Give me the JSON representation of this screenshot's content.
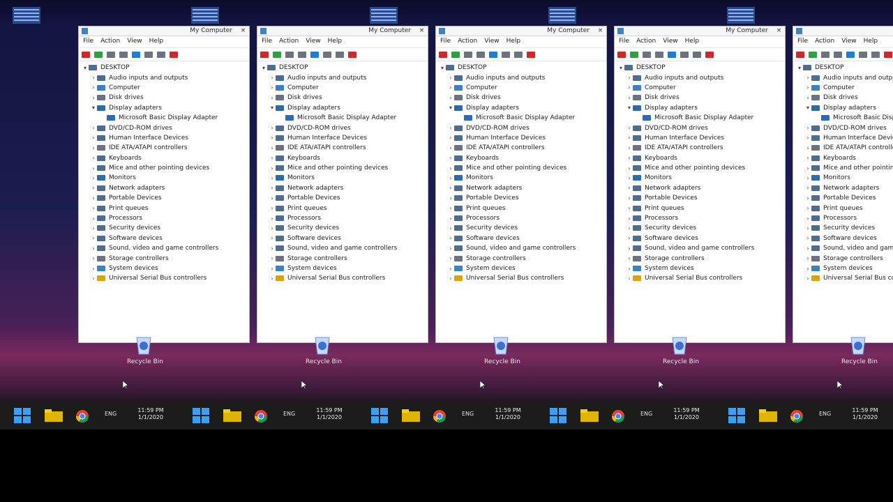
{
  "window": {
    "title": "My Computer",
    "close_glyph": "×",
    "menu": [
      "File",
      "Action",
      "View",
      "Help"
    ]
  },
  "device_tree": [
    {
      "depth": 0,
      "chevron": "▾",
      "icon": "computer",
      "label": "DESKTOP"
    },
    {
      "depth": 1,
      "chevron": "›",
      "icon": "device",
      "label": "Audio inputs and outputs"
    },
    {
      "depth": 1,
      "chevron": "›",
      "icon": "comp",
      "label": "Computer"
    },
    {
      "depth": 1,
      "chevron": "›",
      "icon": "disk",
      "label": "Disk drives"
    },
    {
      "depth": 1,
      "chevron": "▾",
      "icon": "disp",
      "label": "Display adapters"
    },
    {
      "depth": 2,
      "chevron": "",
      "icon": "disp",
      "label": "Microsoft Basic Display Adapter"
    },
    {
      "depth": 1,
      "chevron": "›",
      "icon": "device",
      "label": "DVD/CD-ROM drives"
    },
    {
      "depth": 1,
      "chevron": "›",
      "icon": "device",
      "label": "Human Interface Devices"
    },
    {
      "depth": 1,
      "chevron": "›",
      "icon": "disk",
      "label": "IDE ATA/ATAPI controllers"
    },
    {
      "depth": 1,
      "chevron": "›",
      "icon": "device",
      "label": "Keyboards"
    },
    {
      "depth": 1,
      "chevron": "›",
      "icon": "device",
      "label": "Mice and other pointing devices"
    },
    {
      "depth": 1,
      "chevron": "›",
      "icon": "disp",
      "label": "Monitors"
    },
    {
      "depth": 1,
      "chevron": "›",
      "icon": "device",
      "label": "Network adapters"
    },
    {
      "depth": 1,
      "chevron": "›",
      "icon": "device",
      "label": "Portable Devices"
    },
    {
      "depth": 1,
      "chevron": "›",
      "icon": "device",
      "label": "Print queues"
    },
    {
      "depth": 1,
      "chevron": "›",
      "icon": "device",
      "label": "Processors"
    },
    {
      "depth": 1,
      "chevron": "›",
      "icon": "device",
      "label": "Security devices"
    },
    {
      "depth": 1,
      "chevron": "›",
      "icon": "device",
      "label": "Software devices"
    },
    {
      "depth": 1,
      "chevron": "›",
      "icon": "device",
      "label": "Sound, video and game controllers"
    },
    {
      "depth": 1,
      "chevron": "›",
      "icon": "disk",
      "label": "Storage controllers"
    },
    {
      "depth": 1,
      "chevron": "›",
      "icon": "comp",
      "label": "System devices"
    },
    {
      "depth": 1,
      "chevron": "›",
      "icon": "warn",
      "label": "Universal Serial Bus controllers"
    }
  ],
  "desktop": {
    "recycle_bin_label": "Recycle Bin"
  },
  "taskbar": {
    "tray_text": "ENG",
    "clock_time": "11:59 PM",
    "clock_date": "1/1/2020"
  },
  "colors": {
    "accent": "#1c7ed6",
    "taskbar_bg": "#1c1c1c",
    "wallpaper_top": "#141442",
    "wallpaper_band": "#7a2a5e"
  },
  "icons": {
    "window_icon": "device-manager-icon",
    "recycle": "recycle-bin-icon",
    "start": "start-icon",
    "explorer": "file-explorer-icon",
    "browser": "chrome-icon"
  }
}
